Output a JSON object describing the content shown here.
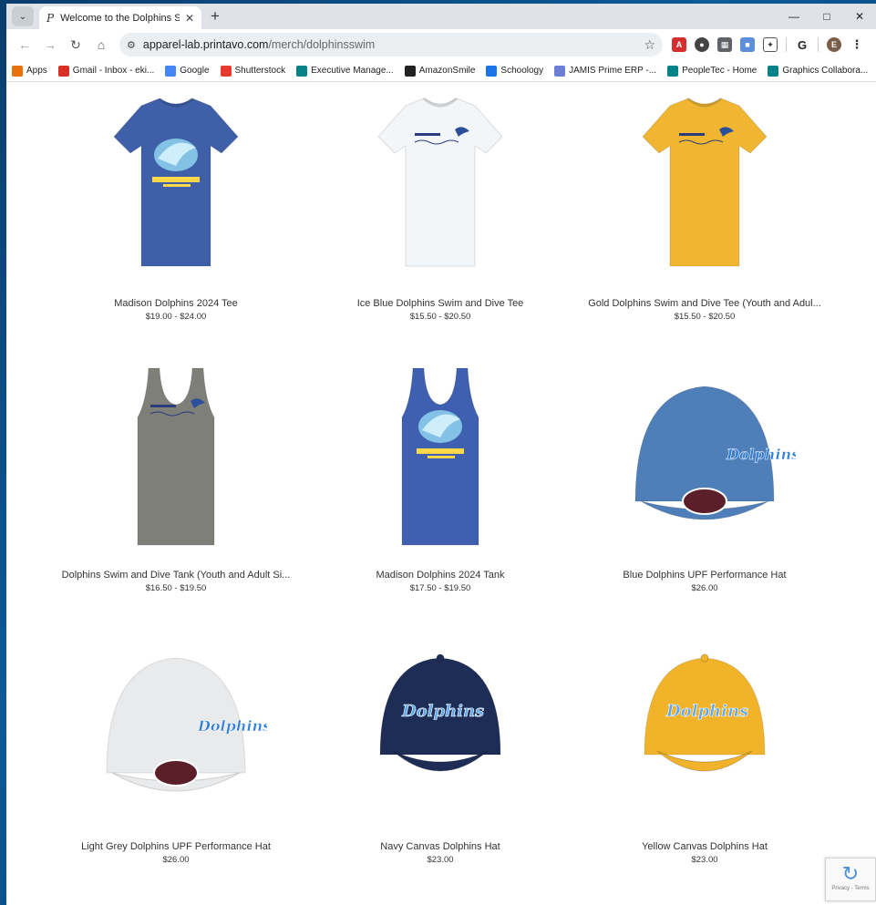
{
  "browser": {
    "tab_title": "Welcome to the Dolphins Swim",
    "tab_favicon": "P",
    "url_host": "apparel-lab.printavo.com",
    "url_path": "/merch/dolphinsswim"
  },
  "bookmarks": [
    {
      "label": "Apps",
      "icon": "apps-grid-icon",
      "color": "#e8710a"
    },
    {
      "label": "Gmail - Inbox - eki...",
      "icon": "gmail-icon",
      "color": "#d93025"
    },
    {
      "label": "Google",
      "icon": "google-icon",
      "color": "#4285f4"
    },
    {
      "label": "Shutterstock",
      "icon": "shutterstock-icon",
      "color": "#e63b2e"
    },
    {
      "label": "Executive Manage...",
      "icon": "sharepoint-icon",
      "color": "#038387"
    },
    {
      "label": "AmazonSmile",
      "icon": "amazon-icon",
      "color": "#222222"
    },
    {
      "label": "Schoology",
      "icon": "schoology-icon",
      "color": "#1a73e8"
    },
    {
      "label": "JAMIS Prime ERP -...",
      "icon": "jamis-icon",
      "color": "#6b7fd7"
    },
    {
      "label": "PeopleTec - Home",
      "icon": "sharepoint-icon",
      "color": "#038387"
    },
    {
      "label": "Graphics Collabora...",
      "icon": "sharepoint-icon",
      "color": "#038387"
    }
  ],
  "products": [
    {
      "name": "Madison Dolphins 2024 Tee",
      "price": "$19.00 - $24.00",
      "kind": "tee",
      "color": "#3f5fa8",
      "print": "big"
    },
    {
      "name": "Ice Blue Dolphins Swim and Dive Tee",
      "price": "$15.50 - $20.50",
      "kind": "tee",
      "color": "#f3f6f8",
      "print": "small"
    },
    {
      "name": "Gold Dolphins Swim and Dive Tee (Youth and Adul...",
      "price": "$15.50 - $20.50",
      "kind": "tee",
      "color": "#f0b631",
      "print": "small"
    },
    {
      "name": "Dolphins Swim and Dive Tank (Youth and Adult Si...",
      "price": "$16.50 - $19.50",
      "kind": "tank",
      "color": "#7d7f78",
      "print": "small"
    },
    {
      "name": "Madison Dolphins 2024 Tank",
      "price": "$17.50 - $19.50",
      "kind": "tank",
      "color": "#3f5fb0",
      "print": "big"
    },
    {
      "name": "Blue Dolphins UPF Performance Hat",
      "price": "$26.00",
      "kind": "hat",
      "color": "#4f7fb8",
      "print": "patch"
    },
    {
      "name": "Light Grey Dolphins UPF Performance Hat",
      "price": "$26.00",
      "kind": "hat",
      "color": "#e9eaec",
      "print": "patch"
    },
    {
      "name": "Navy Canvas Dolphins Hat",
      "price": "$23.00",
      "kind": "cap",
      "color": "#1e2d55",
      "print": "none"
    },
    {
      "name": "Yellow Canvas Dolphins Hat",
      "price": "$23.00",
      "kind": "cap",
      "color": "#f0b32a",
      "print": "none"
    }
  ],
  "recaptcha": {
    "text": "Privacy - Terms"
  }
}
